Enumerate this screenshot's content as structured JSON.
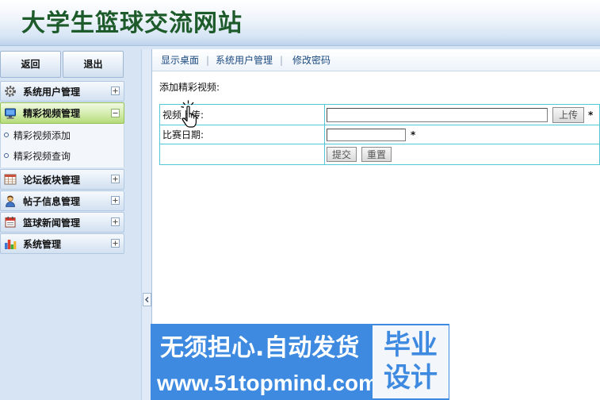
{
  "header": {
    "title": "大学生篮球交流网站"
  },
  "sidebar": {
    "back_label": "返回",
    "logout_label": "退出",
    "menus": [
      {
        "label": "系统用户管理",
        "icon": "gear-icon",
        "toggle_icon": "plus-icon",
        "expanded": false
      },
      {
        "label": "精彩视频管理",
        "icon": "monitor-icon",
        "toggle_icon": "minus-icon",
        "expanded": true,
        "items": [
          {
            "label": "精彩视频添加"
          },
          {
            "label": "精彩视频查询"
          }
        ]
      },
      {
        "label": "论坛板块管理",
        "icon": "table-icon",
        "toggle_icon": "plus-icon",
        "expanded": false
      },
      {
        "label": "帖子信息管理",
        "icon": "user-icon",
        "toggle_icon": "plus-icon",
        "expanded": false
      },
      {
        "label": "篮球新闻管理",
        "icon": "calendar-icon",
        "toggle_icon": "plus-icon",
        "expanded": false
      },
      {
        "label": "系统管理",
        "icon": "bar-chart-icon",
        "toggle_icon": "plus-icon",
        "expanded": false
      }
    ],
    "collapse_icon": "chevron-left-icon"
  },
  "topnav": {
    "links": [
      {
        "label": "显示桌面"
      },
      {
        "label": "系统用户管理"
      },
      {
        "label": "修改密码"
      }
    ],
    "separator": "|"
  },
  "form": {
    "heading": "添加精彩视频:",
    "video_upload": {
      "label": "视频上传:",
      "value": "",
      "button": "上传",
      "required_mark": "*"
    },
    "match_date": {
      "label": "比赛日期:",
      "value": "",
      "required_mark": "*"
    },
    "submit_label": "提交",
    "reset_label": "重置"
  },
  "cursor": {
    "icon": "hand-pointer-icon"
  },
  "watermark": {
    "slogan": "无须担心.自动发货",
    "url": "www.51topmind.com",
    "badge_line1": "毕业",
    "badge_line2": "设计"
  },
  "colors": {
    "title": "#1e5b2b",
    "active_menu": "#b5dc7a",
    "table_border": "#55c8d6",
    "nav_link": "#1b4a80",
    "watermark_bg": "#3d8ae0"
  }
}
